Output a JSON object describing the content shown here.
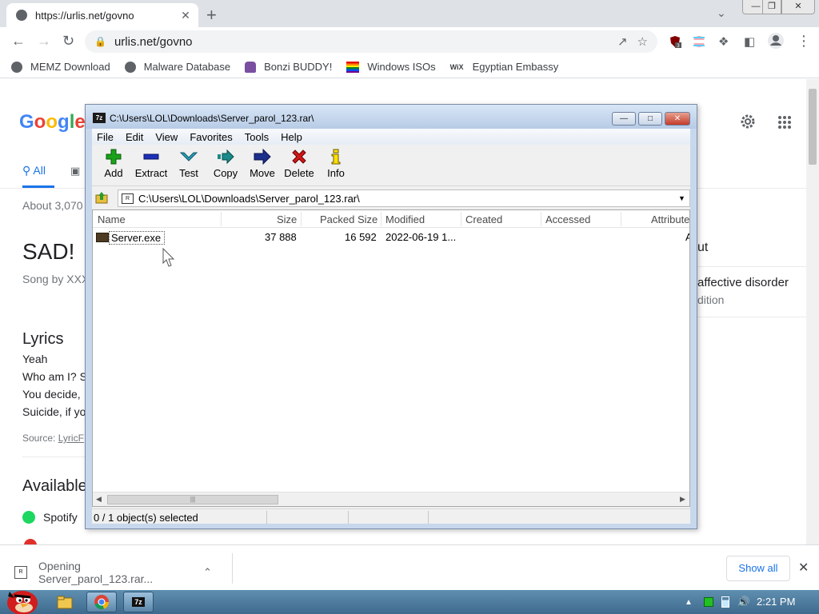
{
  "browser": {
    "tab_title": "https://urlis.net/govno",
    "tab_close": "✕",
    "new_tab": "+",
    "tab_search": "⌄",
    "url": "urlis.net/govno",
    "extension_badge": "3",
    "bookmarks": [
      {
        "label": "MEMZ Download"
      },
      {
        "label": "Malware Database"
      },
      {
        "label": "Bonzi BUDDY!"
      },
      {
        "label": "Windows ISOs"
      },
      {
        "label": "Egyptian Embassy"
      }
    ]
  },
  "google": {
    "tab_all": "All",
    "about": "About 3,070",
    "song_title": "SAD!",
    "song_by": "Song by XXX",
    "right_side_1": "ut",
    "right_side_2": "affective disorder",
    "right_side_3": "dition",
    "lyrics_heading": "Lyrics",
    "lyrics_lines": [
      "Yeah",
      "Who am I? S",
      "You decide,",
      "Suicide, if yo"
    ],
    "source_label": "Source: ",
    "source_link": "LyricF",
    "available": "Available",
    "spotify": "Spotify"
  },
  "sevenzip": {
    "title": "C:\\Users\\LOL\\Downloads\\Server_parol_123.rar\\",
    "app_icon": "7z",
    "menu": [
      "File",
      "Edit",
      "View",
      "Favorites",
      "Tools",
      "Help"
    ],
    "tools": [
      {
        "label": "Add",
        "icon": "plus-icon",
        "color": "#1aa31a"
      },
      {
        "label": "Extract",
        "icon": "minus-icon",
        "color": "#1c2fb8"
      },
      {
        "label": "Test",
        "icon": "check-chevron-icon",
        "color": "#2aa0b8"
      },
      {
        "label": "Copy",
        "icon": "arrow-right-double-icon",
        "color": "#1a8a8a"
      },
      {
        "label": "Move",
        "icon": "arrow-right-icon",
        "color": "#1c2f8a"
      },
      {
        "label": "Delete",
        "icon": "x-icon",
        "color": "#d01818"
      },
      {
        "label": "Info",
        "icon": "info-icon",
        "color": "#c8a000"
      }
    ],
    "address": "C:\\Users\\LOL\\Downloads\\Server_parol_123.rar\\",
    "columns": [
      "Name",
      "Size",
      "Packed Size",
      "Modified",
      "Created",
      "Accessed",
      "Attribute"
    ],
    "files": [
      {
        "name": "Server.exe",
        "size": "37 888",
        "packed": "16 592",
        "modified": "2022-06-19 1...",
        "created": "",
        "accessed": "",
        "attr": "A"
      }
    ],
    "status": "0 / 1 object(s) selected"
  },
  "download": {
    "filename": "Opening Server_parol_123.rar...",
    "show_all": "Show all"
  },
  "taskbar": {
    "clock": "2:21 PM",
    "seven_zip_label": "7z"
  }
}
